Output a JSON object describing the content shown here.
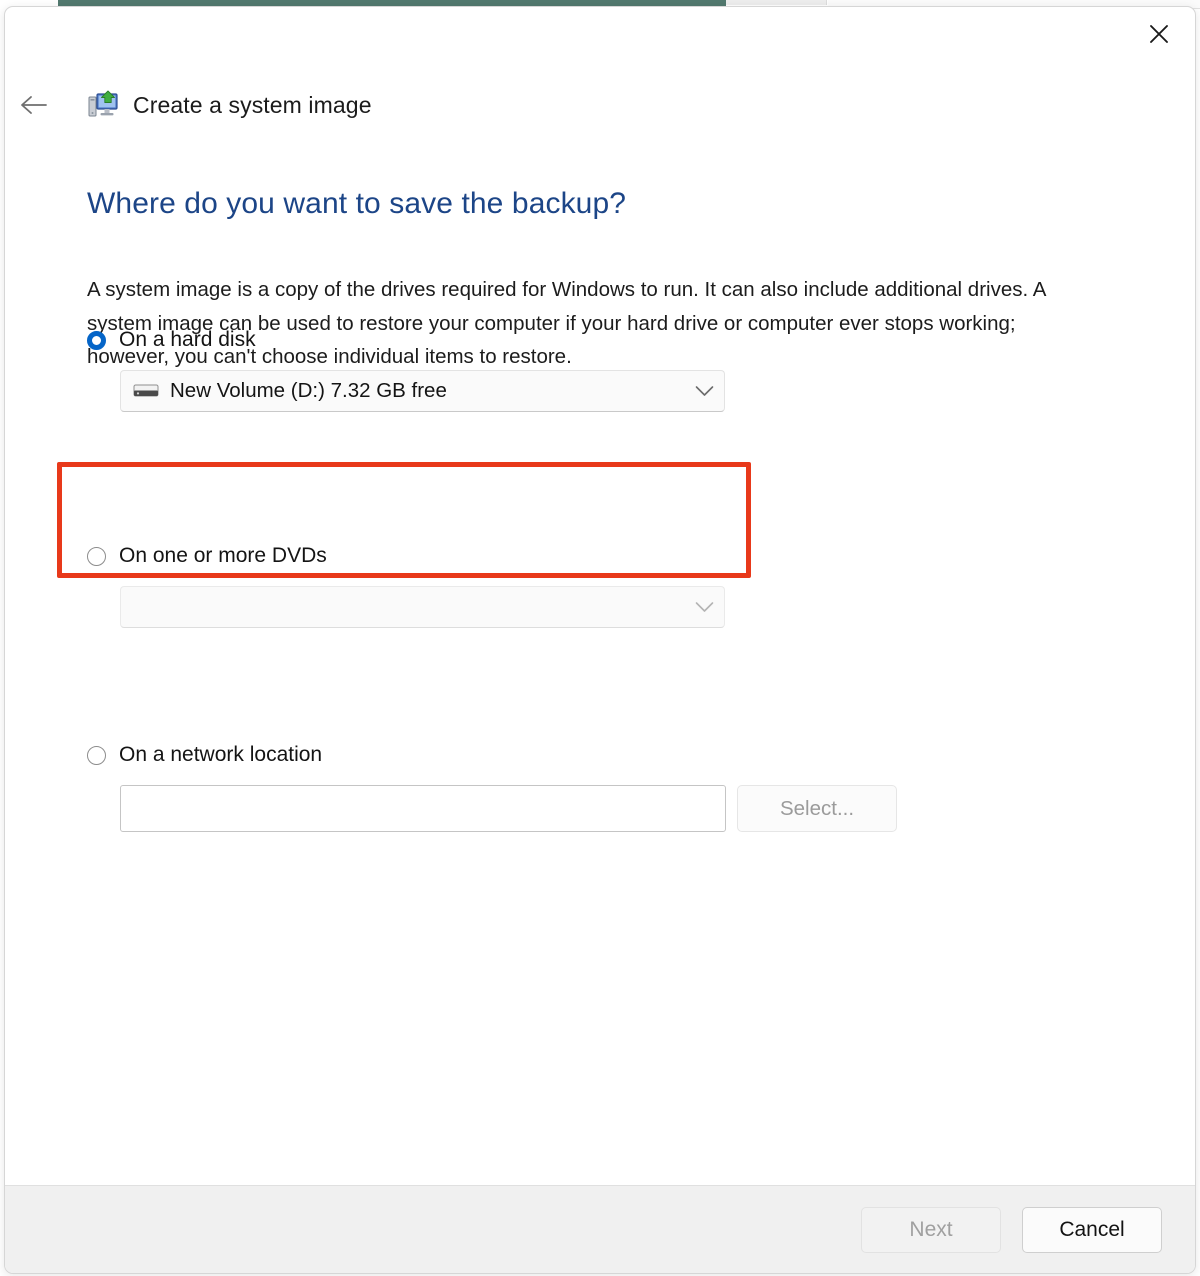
{
  "window": {
    "title": "Create a system image",
    "title_icon": "create-system-image-icon",
    "close_icon": "close-icon",
    "back_icon": "back-arrow-icon"
  },
  "content": {
    "heading": "Where do you want to save the backup?",
    "description": "A system image is a copy of the drives required for Windows to run. It can also include additional drives. A system image can be used to restore your computer if your hard drive or computer ever stops working; however, you can't choose individual items to restore."
  },
  "options": {
    "hard_disk": {
      "label": "On a hard disk",
      "selected": true,
      "combo_value": "New Volume (D:)  7.32 GB free",
      "drive_icon": "hard-disk-icon",
      "chevron_icon": "chevron-down-icon"
    },
    "dvd": {
      "label": "On one or more DVDs",
      "selected": false,
      "combo_value": "",
      "chevron_icon": "chevron-down-icon"
    },
    "network": {
      "label": "On a network location",
      "selected": false,
      "input_value": "",
      "input_placeholder": "",
      "select_label": "Select..."
    }
  },
  "footer": {
    "next_label": "Next",
    "cancel_label": "Cancel"
  },
  "annotation": {
    "highlight_color": "#e8391a",
    "target": "on-a-hard-disk-option"
  },
  "colors": {
    "heading": "#1c4587",
    "accent_radio": "#0565c8",
    "footer_bg": "#f0f0f0",
    "background_window_band": "#52796f"
  }
}
